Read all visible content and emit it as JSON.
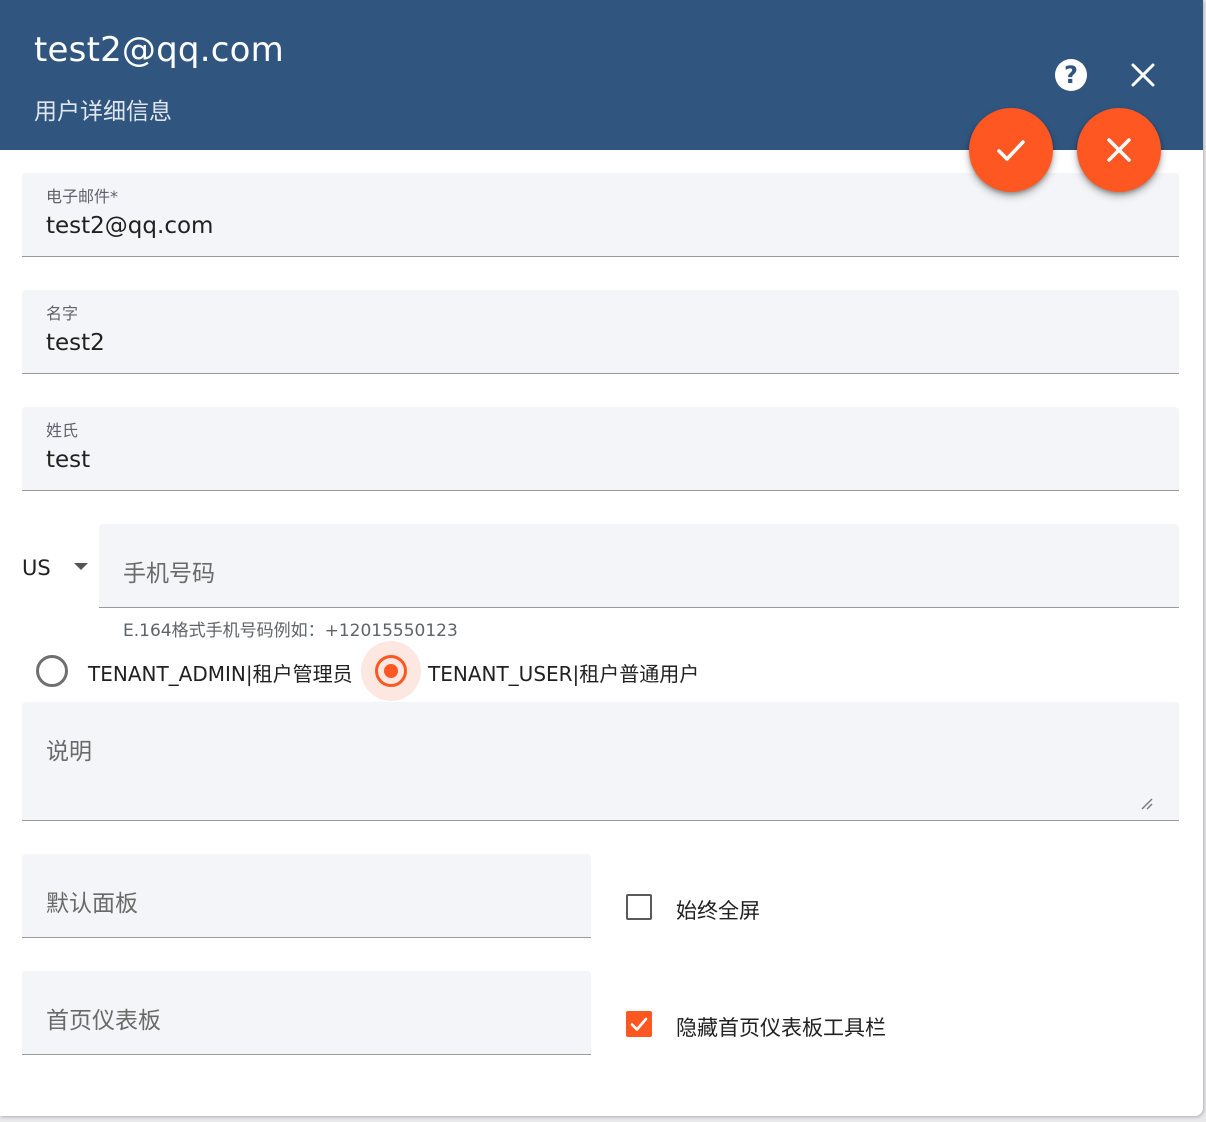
{
  "header": {
    "title": "test2@qq.com",
    "subtitle": "用户详细信息",
    "help_symbol": "?",
    "help_icon": "help-circle-icon",
    "close_icon": "close-icon",
    "background_color": "#305680"
  },
  "actions": {
    "save_icon": "check-icon",
    "cancel_icon": "close-icon",
    "accent_color": "#ff5722"
  },
  "form": {
    "email": {
      "label": "电子邮件*",
      "value": "test2@qq.com"
    },
    "first_name": {
      "label": "名字",
      "value": "test2"
    },
    "last_name": {
      "label": "姓氏",
      "value": "test"
    },
    "phone": {
      "country": "US",
      "placeholder": "手机号码",
      "hint": "E.164格式手机号码例如：+12015550123"
    },
    "roles": [
      {
        "label": "TENANT_ADMIN|租户管理员",
        "selected": false
      },
      {
        "label": "TENANT_USER|租户普通用户",
        "selected": true
      }
    ],
    "description": {
      "placeholder": "说明"
    },
    "default_dashboard": {
      "placeholder": "默认面板"
    },
    "home_dashboard": {
      "placeholder": "首页仪表板"
    },
    "always_fullscreen": {
      "label": "始终全屏",
      "checked": false
    },
    "hide_toolbar": {
      "label": "隐藏首页仪表板工具栏",
      "checked": true
    }
  }
}
